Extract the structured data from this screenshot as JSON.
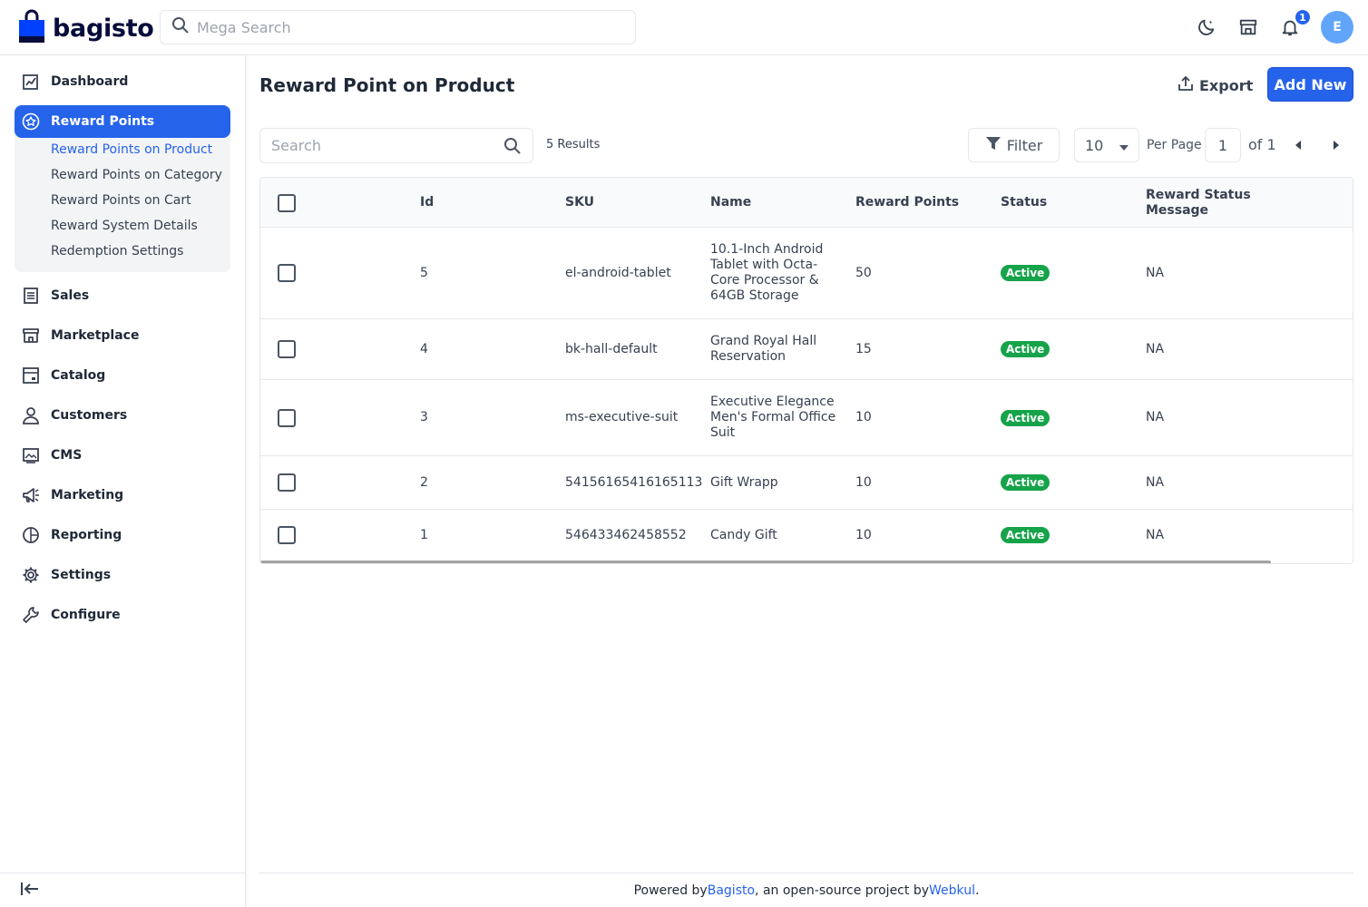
{
  "header": {
    "logo_text": "bagisto",
    "search_placeholder": "Mega Search",
    "notification_count": "1",
    "avatar_initial": "E"
  },
  "sidebar": {
    "items": [
      {
        "label": "Dashboard",
        "icon": "dashboard-icon"
      },
      {
        "label": "Reward Points",
        "icon": "star-icon",
        "active": true
      },
      {
        "label": "Sales",
        "icon": "sales-icon"
      },
      {
        "label": "Marketplace",
        "icon": "store-icon"
      },
      {
        "label": "Catalog",
        "icon": "catalog-icon"
      },
      {
        "label": "Customers",
        "icon": "user-icon"
      },
      {
        "label": "CMS",
        "icon": "cms-icon"
      },
      {
        "label": "Marketing",
        "icon": "megaphone-icon"
      },
      {
        "label": "Reporting",
        "icon": "chart-icon"
      },
      {
        "label": "Settings",
        "icon": "gear-icon"
      },
      {
        "label": "Configure",
        "icon": "wrench-icon"
      }
    ],
    "submenu": [
      "Reward Points on Product",
      "Reward Points on Category",
      "Reward Points on Cart",
      "Reward System Details",
      "Redemption Settings"
    ]
  },
  "main": {
    "title": "Reward Point on Product",
    "export_label": "Export",
    "add_new_label": "Add New",
    "search_placeholder": "Search",
    "results_text": "5 Results",
    "filter_label": "Filter",
    "per_page_value": "10",
    "per_page_label": "Per Page",
    "page_value": "1",
    "of_text": "of 1"
  },
  "table": {
    "columns": [
      "Id",
      "SKU",
      "Name",
      "Reward Points",
      "Status",
      "Reward Status Message"
    ],
    "rows": [
      {
        "id": "5",
        "sku": "el-android-tablet",
        "name": "10.1-Inch Android Tablet with Octa-Core Processor & 64GB Storage",
        "points": "50",
        "status": "Active",
        "message": "NA"
      },
      {
        "id": "4",
        "sku": "bk-hall-default",
        "name": "Grand Royal Hall Reservation",
        "points": "15",
        "status": "Active",
        "message": "NA"
      },
      {
        "id": "3",
        "sku": "ms-executive-suit",
        "name": "Executive Elegance Men's Formal Office Suit",
        "points": "10",
        "status": "Active",
        "message": "NA"
      },
      {
        "id": "2",
        "sku": "54156165416165113",
        "name": "Gift Wrapp",
        "points": "10",
        "status": "Active",
        "message": "NA"
      },
      {
        "id": "1",
        "sku": "546433462458552",
        "name": "Candy Gift",
        "points": "10",
        "status": "Active",
        "message": "NA"
      }
    ]
  },
  "footer": {
    "prefix": "Powered by ",
    "link1": "Bagisto",
    "middle": ", an open-source project by ",
    "link2": "Webkul",
    "suffix": "."
  },
  "colors": {
    "accent": "#2563eb",
    "active_badge": "#16a34a"
  }
}
